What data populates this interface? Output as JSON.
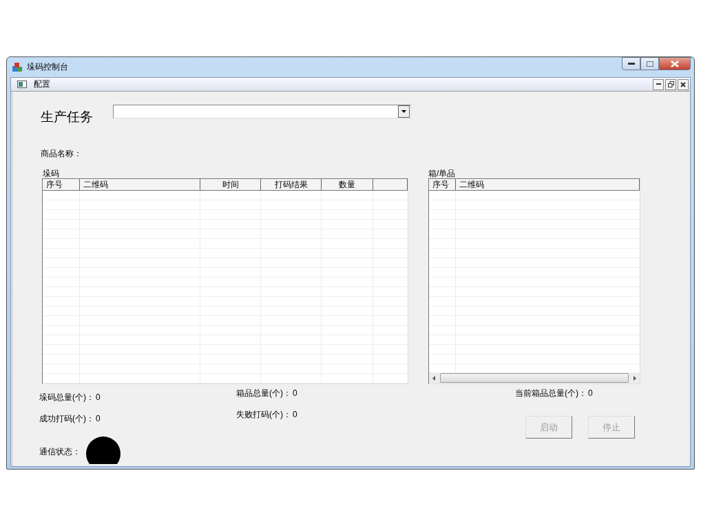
{
  "window": {
    "title": "垛码控制台"
  },
  "child_window": {
    "title": "配置"
  },
  "production_task": {
    "label": "生产任务"
  },
  "product_name": {
    "label": "商品名称："
  },
  "stack_table": {
    "title": "垛码",
    "columns": [
      "序号",
      "二维码",
      "时间",
      "打码结果",
      "数量"
    ]
  },
  "box_table": {
    "title": "箱/单品",
    "columns": [
      "序号",
      "二维码"
    ]
  },
  "stats_left": [
    {
      "label": "垛码总量(个)：",
      "value": "0"
    },
    {
      "label": "成功打码(个)：",
      "value": "0"
    }
  ],
  "stats_middle": [
    {
      "label": "箱品总量(个)：",
      "value": "0"
    },
    {
      "label": "失败打码(个)：",
      "value": "0"
    }
  ],
  "stats_right": [
    {
      "label": "当前箱品总量(个)：",
      "value": "0"
    }
  ],
  "status": {
    "label": "通信状态：",
    "color": "#000000"
  },
  "buttons": [
    {
      "label": "启动",
      "disabled": true
    },
    {
      "label": "停止",
      "disabled": true
    }
  ]
}
